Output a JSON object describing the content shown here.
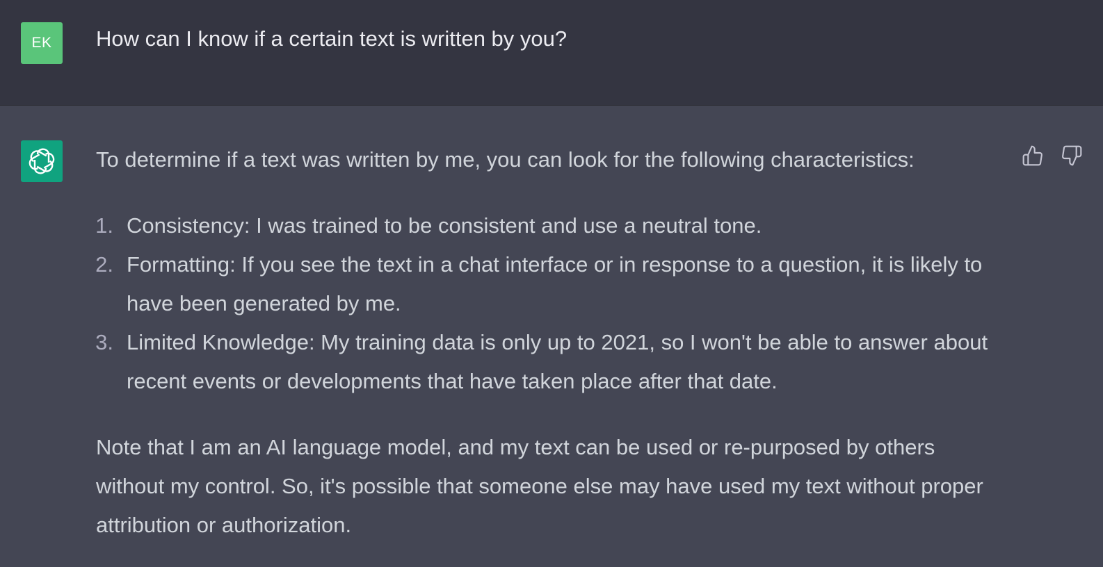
{
  "user_message": {
    "avatar_initials": "EK",
    "avatar_color": "#5ac57a",
    "text": "How can I know if a certain text is written by you?"
  },
  "assistant_message": {
    "avatar_icon": "openai-logo-icon",
    "avatar_color": "#10a37f",
    "intro": "To determine if a text was written by me, you can look for the following characteristics:",
    "points": [
      {
        "number": "1.",
        "text": "Consistency: I was trained to be consistent and use a neutral tone."
      },
      {
        "number": "2.",
        "text": "Formatting: If you see the text in a chat interface or in response to a question, it is likely to have been generated by me."
      },
      {
        "number": "3.",
        "text": "Limited Knowledge: My training data is only up to 2021, so I won't be able to answer about recent events or developments that have taken place after that date."
      }
    ],
    "outro": "Note that I am an AI language model, and my text can be used or re-purposed by others without my control. So, it's possible that someone else may have used my text without proper attribution or authorization.",
    "feedback": {
      "thumbs_up_icon": "thumbs-up-icon",
      "thumbs_down_icon": "thumbs-down-icon"
    }
  },
  "colors": {
    "user_bg": "#343541",
    "assistant_bg": "#444654",
    "text": "#d1d5db"
  }
}
